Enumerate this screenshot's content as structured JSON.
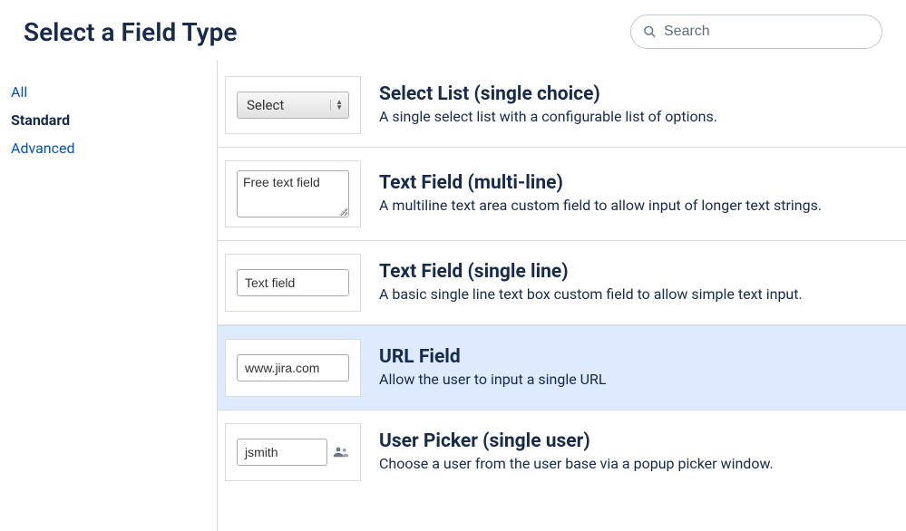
{
  "header": {
    "title": "Select a Field Type",
    "search_placeholder": "Search"
  },
  "sidebar": {
    "items": [
      {
        "label": "All",
        "active": false
      },
      {
        "label": "Standard",
        "active": true
      },
      {
        "label": "Advanced",
        "active": false
      }
    ]
  },
  "fields": [
    {
      "title": "Select List (single choice)",
      "description": "A single select list with a configurable list of options.",
      "preview_text": "Select",
      "selected": false,
      "type": "select"
    },
    {
      "title": "Text Field (multi-line)",
      "description": "A multiline text area custom field to allow input of longer text strings.",
      "preview_text": "Free text field",
      "selected": false,
      "type": "textarea"
    },
    {
      "title": "Text Field (single line)",
      "description": "A basic single line text box custom field to allow simple text input.",
      "preview_text": "Text field",
      "selected": false,
      "type": "input"
    },
    {
      "title": "URL Field",
      "description": "Allow the user to input a single URL",
      "preview_text": "www.jira.com",
      "selected": true,
      "type": "input"
    },
    {
      "title": "User Picker (single user)",
      "description": "Choose a user from the user base via a popup picker window.",
      "preview_text": "jsmith",
      "selected": false,
      "type": "user"
    }
  ]
}
